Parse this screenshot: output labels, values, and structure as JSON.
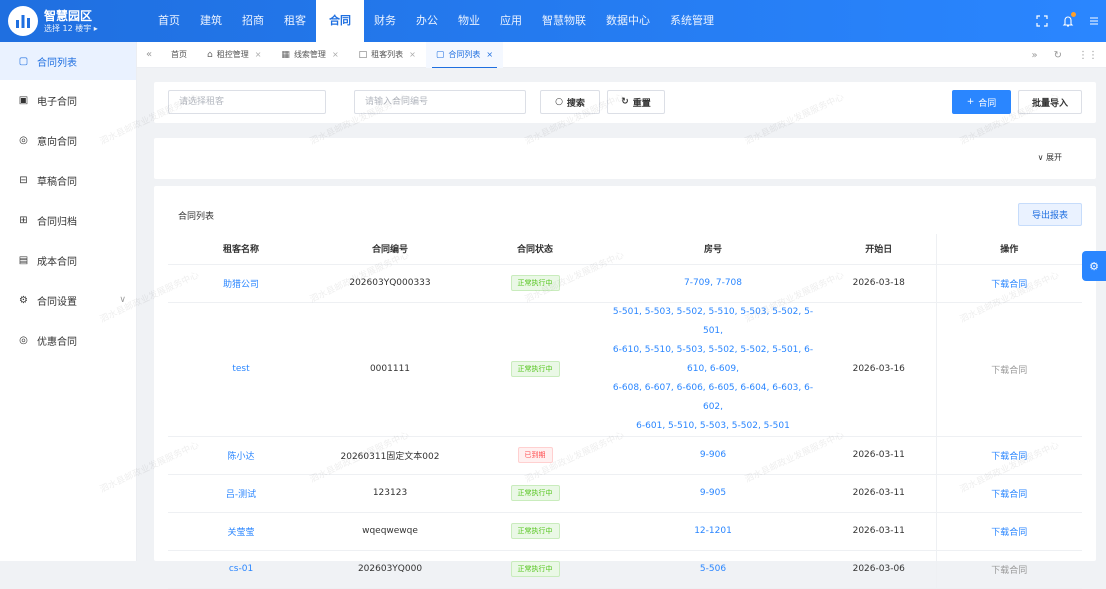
{
  "app": {
    "title": "智慧园区",
    "building_selector": "选择 12 楼宇 ▸"
  },
  "nav": [
    "首页",
    "建筑",
    "招商",
    "租客",
    "合同",
    "财务",
    "办公",
    "物业",
    "应用",
    "智慧物联",
    "数据中心",
    "系统管理"
  ],
  "nav_active_index": 4,
  "sidebar": {
    "items": [
      {
        "label": "合同列表",
        "icon": "document-icon",
        "active": true
      },
      {
        "label": "电子合同",
        "icon": "save-icon"
      },
      {
        "label": "意向合同",
        "icon": "pin-icon"
      },
      {
        "label": "草稿合同",
        "icon": "inbox-icon"
      },
      {
        "label": "合同归档",
        "icon": "archive-icon"
      },
      {
        "label": "成本合同",
        "icon": "ledger-icon"
      },
      {
        "label": "合同设置",
        "icon": "gear-icon",
        "has_caret": true
      },
      {
        "label": "优惠合同",
        "icon": "pin-icon"
      }
    ]
  },
  "tabs": [
    {
      "label": "首页",
      "icon": "",
      "closable": false
    },
    {
      "label": "租控管理",
      "icon": "home-icon",
      "closable": true
    },
    {
      "label": "线索管理",
      "icon": "calendar-icon",
      "closable": true
    },
    {
      "label": "租客列表",
      "icon": "square-icon",
      "closable": true
    },
    {
      "label": "合同列表",
      "icon": "document-icon",
      "closable": true,
      "active": true
    }
  ],
  "search": {
    "tenant_placeholder": "请选择租客",
    "contract_no_placeholder": "请输入合同编号",
    "search_label": "搜索",
    "reset_label": "重置",
    "add_label": "合同",
    "import_label": "批量导入",
    "expand_label": "展开"
  },
  "table": {
    "title": "合同列表",
    "export_label": "导出报表",
    "columns": [
      "租客名称",
      "合同编号",
      "合同状态",
      "房号",
      "开始日",
      "操作"
    ],
    "rows": [
      {
        "tenant": "助猎公司",
        "contract_no": "202603YQ000333",
        "status": "正常执行中",
        "status_type": "ok",
        "rooms": [
          "7-709, 7-708"
        ],
        "start": "2026-03-18",
        "action": "下载合同",
        "action_enabled": true,
        "tenant_link": true
      },
      {
        "tenant": "test",
        "contract_no": "0001111",
        "status": "正常执行中",
        "status_type": "ok",
        "rooms": [
          "5-501, 5-503, 5-502, 5-510, 5-503, 5-502, 5-501,",
          "6-610, 5-510, 5-503, 5-502, 5-502, 5-501, 6-610, 6-609,",
          "6-608, 6-607, 6-606, 6-605, 6-604, 6-603, 6-602,",
          "6-601, 5-510, 5-503, 5-502, 5-501"
        ],
        "start": "2026-03-16",
        "action": "下载合同",
        "action_enabled": false,
        "tenant_link": true
      },
      {
        "tenant": "陈小达",
        "contract_no": "20260311固定文本002",
        "status": "已到期",
        "status_type": "exp",
        "rooms": [
          "9-906"
        ],
        "start": "2026-03-11",
        "action": "下载合同",
        "action_enabled": true,
        "tenant_link": true
      },
      {
        "tenant": "吕-测试",
        "contract_no": "123123",
        "status": "正常执行中",
        "status_type": "ok",
        "rooms": [
          "9-905"
        ],
        "start": "2026-03-11",
        "action": "下载合同",
        "action_enabled": true,
        "tenant_link": true
      },
      {
        "tenant": "关莹莹",
        "contract_no": "wqeqwewqe",
        "status": "正常执行中",
        "status_type": "ok",
        "rooms": [
          "12-1201"
        ],
        "start": "2026-03-11",
        "action": "下载合同",
        "action_enabled": true,
        "tenant_link": true
      },
      {
        "tenant": "cs-01",
        "contract_no": "202603YQ000",
        "status": "正常执行中",
        "status_type": "ok",
        "rooms": [
          "5-506"
        ],
        "start": "2026-03-06",
        "action": "下载合同",
        "action_enabled": false,
        "tenant_link": true
      }
    ]
  },
  "watermark": "泗水县邮政业发展服务中心",
  "colors": {
    "primary": "#2a86ff",
    "topbar": "#1f6fe0",
    "ok": "#52c41a",
    "expired": "#ff4d4f"
  }
}
